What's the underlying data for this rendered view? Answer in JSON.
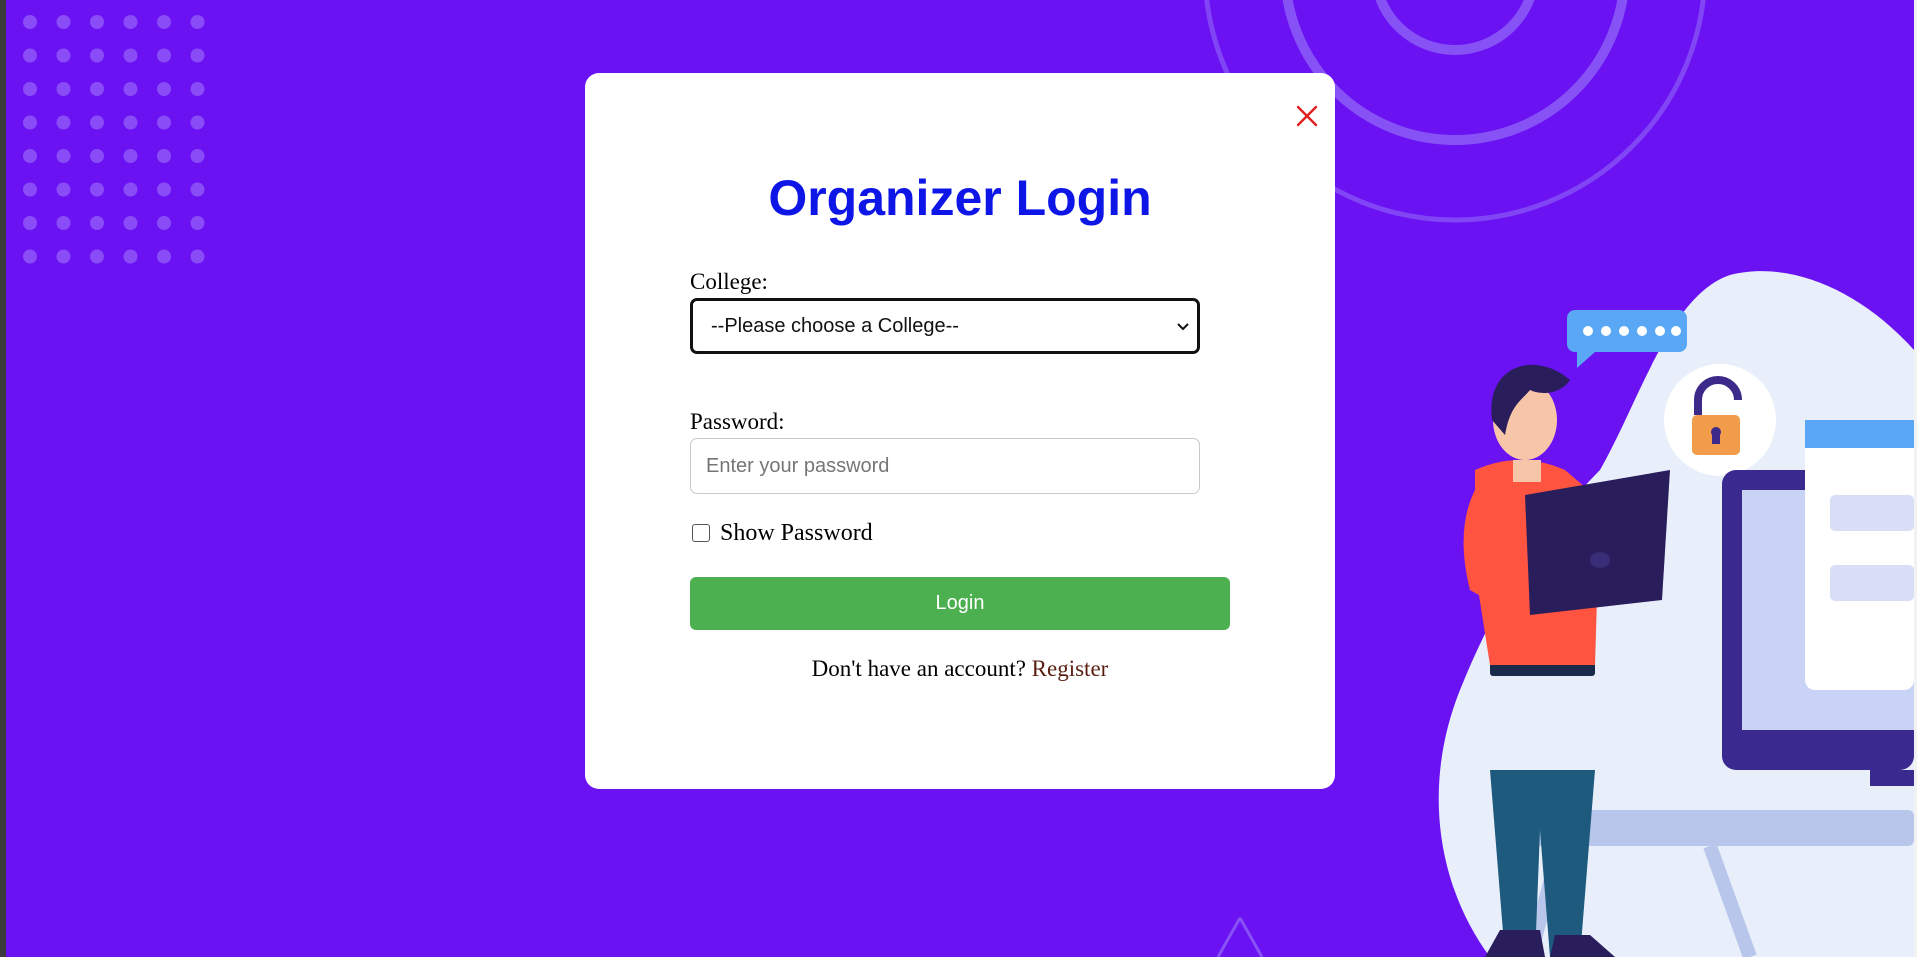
{
  "login_modal": {
    "title": "Organizer Login",
    "close_icon": "close-icon",
    "college": {
      "label": "College:",
      "selected_option": "--Please choose a College--"
    },
    "password": {
      "label": "Password:",
      "placeholder": "Enter your password",
      "value": ""
    },
    "show_password": {
      "label": "Show Password",
      "checked": false
    },
    "login_button": "Login",
    "register_prompt": "Don't have an account?",
    "register_link": "Register"
  },
  "colors": {
    "background": "#6a12f2",
    "title": "#0d16e6",
    "login_button": "#4caf50",
    "close_icon": "#e02020",
    "register_link": "#5a1e10"
  }
}
